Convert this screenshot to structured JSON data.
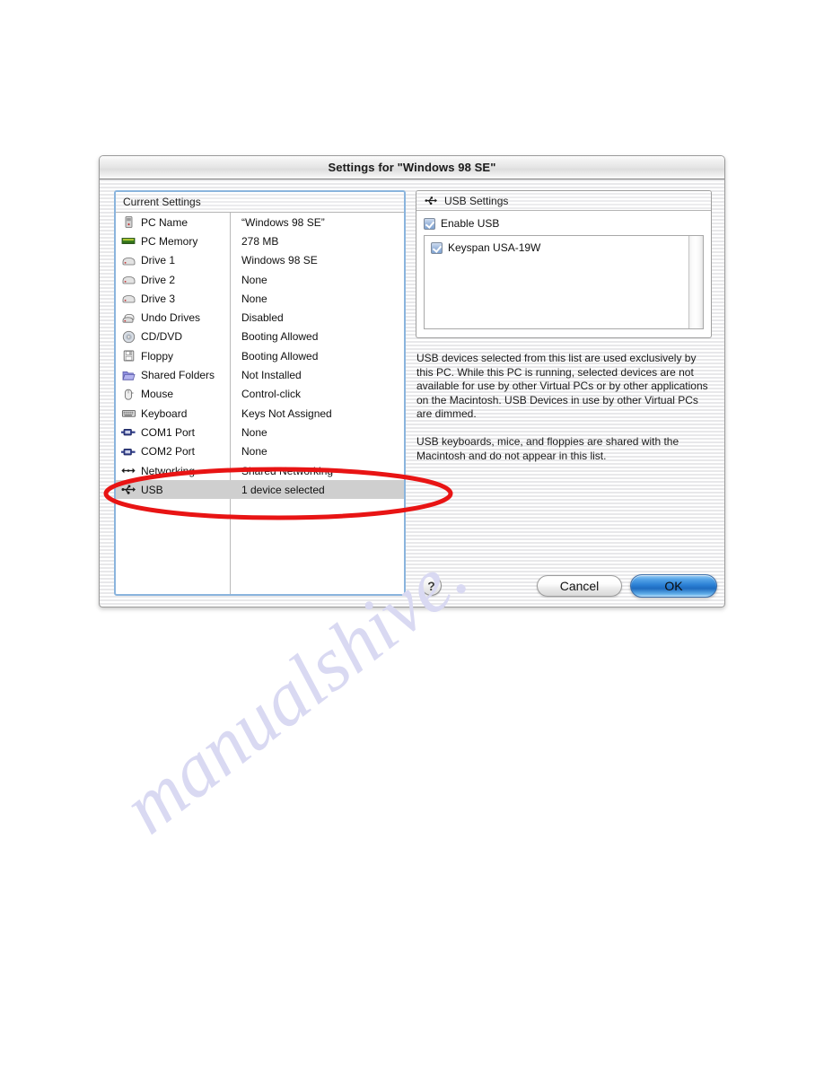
{
  "window": {
    "title": "Settings for \"Windows 98 SE\""
  },
  "settings_list": {
    "header": "Current Settings",
    "rows": [
      {
        "icon": "pc-tower-icon",
        "name": "PC Name",
        "value": "“Windows 98 SE”",
        "selected": false
      },
      {
        "icon": "memory-chip-icon",
        "name": "PC Memory",
        "value": "278 MB",
        "selected": false
      },
      {
        "icon": "hard-drive-icon",
        "name": "Drive 1",
        "value": "Windows 98 SE",
        "selected": false
      },
      {
        "icon": "hard-drive-icon",
        "name": "Drive 2",
        "value": "None",
        "selected": false
      },
      {
        "icon": "hard-drive-icon",
        "name": "Drive 3",
        "value": "None",
        "selected": false
      },
      {
        "icon": "undo-drive-icon",
        "name": "Undo Drives",
        "value": "Disabled",
        "selected": false
      },
      {
        "icon": "cd-dvd-icon",
        "name": "CD/DVD",
        "value": "Booting Allowed",
        "selected": false
      },
      {
        "icon": "floppy-disk-icon",
        "name": "Floppy",
        "value": "Booting Allowed",
        "selected": false
      },
      {
        "icon": "shared-folder-icon",
        "name": "Shared Folders",
        "value": "Not Installed",
        "selected": false
      },
      {
        "icon": "mouse-icon",
        "name": "Mouse",
        "value": "Control-click",
        "selected": false
      },
      {
        "icon": "keyboard-icon",
        "name": "Keyboard",
        "value": "Keys Not Assigned",
        "selected": false
      },
      {
        "icon": "serial-port-icon",
        "name": "COM1 Port",
        "value": "None",
        "selected": false
      },
      {
        "icon": "serial-port-icon",
        "name": "COM2 Port",
        "value": "None",
        "selected": false
      },
      {
        "icon": "network-icon",
        "name": "Networking",
        "value": "Shared Networking",
        "selected": false
      },
      {
        "icon": "usb-icon",
        "name": "USB",
        "value": "1 device selected",
        "selected": true
      }
    ]
  },
  "usb_settings": {
    "header": "USB Settings",
    "enable_usb": {
      "label": "Enable USB",
      "checked": true
    },
    "devices": [
      {
        "label": "Keyspan USA-19W",
        "checked": true
      }
    ],
    "description_paragraph_1": "USB devices selected from this list are used exclusively by this PC. While this PC is running, selected devices are not available for use by other Virtual PCs or by other applications on the Macintosh. USB Devices in use by other Virtual PCs are dimmed.",
    "description_paragraph_2": "USB keyboards, mice, and floppies are shared with the Macintosh and do not appear in this list."
  },
  "buttons": {
    "help": "?",
    "cancel": "Cancel",
    "ok": "OK"
  },
  "annotation": {
    "color": "#e81414"
  },
  "watermark": {
    "text": "manualshive.",
    "color": "#d9d9f2"
  }
}
